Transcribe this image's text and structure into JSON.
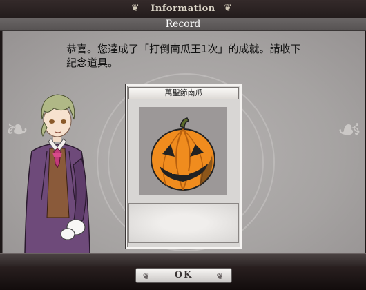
{
  "window": {
    "title": "Information",
    "subtitle": "Record"
  },
  "dialog": {
    "message_line1": "恭喜。您達成了「打倒南瓜王1次」的成就。請收下",
    "message_line2": "紀念道具。"
  },
  "reward_card": {
    "name": "萬聖節南瓜",
    "image_icon": "jack-o-lantern-icon"
  },
  "footer": {
    "ok_label": "OK"
  },
  "colors": {
    "title_bar": "#2b2323",
    "subtitle_bar": "#5f5b5b",
    "panel": "#aba8a7",
    "pumpkin": "#f08c1e",
    "coat": "#6e4a7a"
  }
}
